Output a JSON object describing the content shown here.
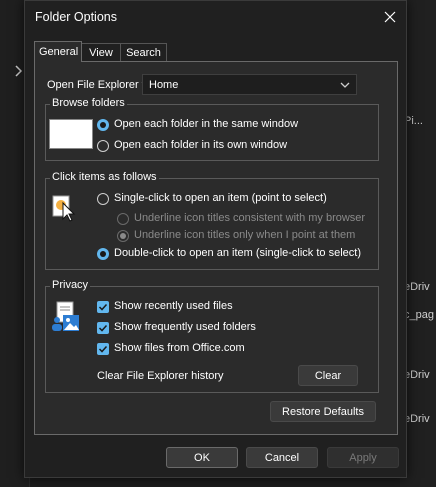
{
  "dialog": {
    "title": "Folder Options"
  },
  "tabs": [
    {
      "label": "General",
      "active": true
    },
    {
      "label": "View",
      "active": false
    },
    {
      "label": "Search",
      "active": false
    }
  ],
  "open_explorer": {
    "label": "Open File Explorer to:",
    "value": "Home"
  },
  "browse_folders": {
    "title": "Browse folders",
    "option_same": "Open each folder in the same window",
    "option_own": "Open each folder in its own window",
    "selected": "same"
  },
  "click_items": {
    "title": "Click items as follows",
    "single_click": "Single-click to open an item (point to select)",
    "underline_consistent": "Underline icon titles consistent with my browser",
    "underline_point": "Underline icon titles only when I point at them",
    "double_click": "Double-click to open an item (single-click to select)",
    "selected": "double"
  },
  "privacy": {
    "title": "Privacy",
    "recent_files": "Show recently used files",
    "frequent_folders": "Show frequently used folders",
    "office_files": "Show files from Office.com",
    "clear_history_label": "Clear File Explorer history",
    "clear_button": "Clear"
  },
  "buttons": {
    "restore_defaults": "Restore Defaults",
    "ok": "OK",
    "cancel": "Cancel",
    "apply": "Apply"
  },
  "background": {
    "right_snippets": [
      "Pi...",
      "eDriv",
      "c_pag",
      "eDriv",
      "eDriv"
    ]
  },
  "colors": {
    "accent": "#62b7ee",
    "dialog_bg": "#202020",
    "panel_bg": "#2b2b2b"
  }
}
